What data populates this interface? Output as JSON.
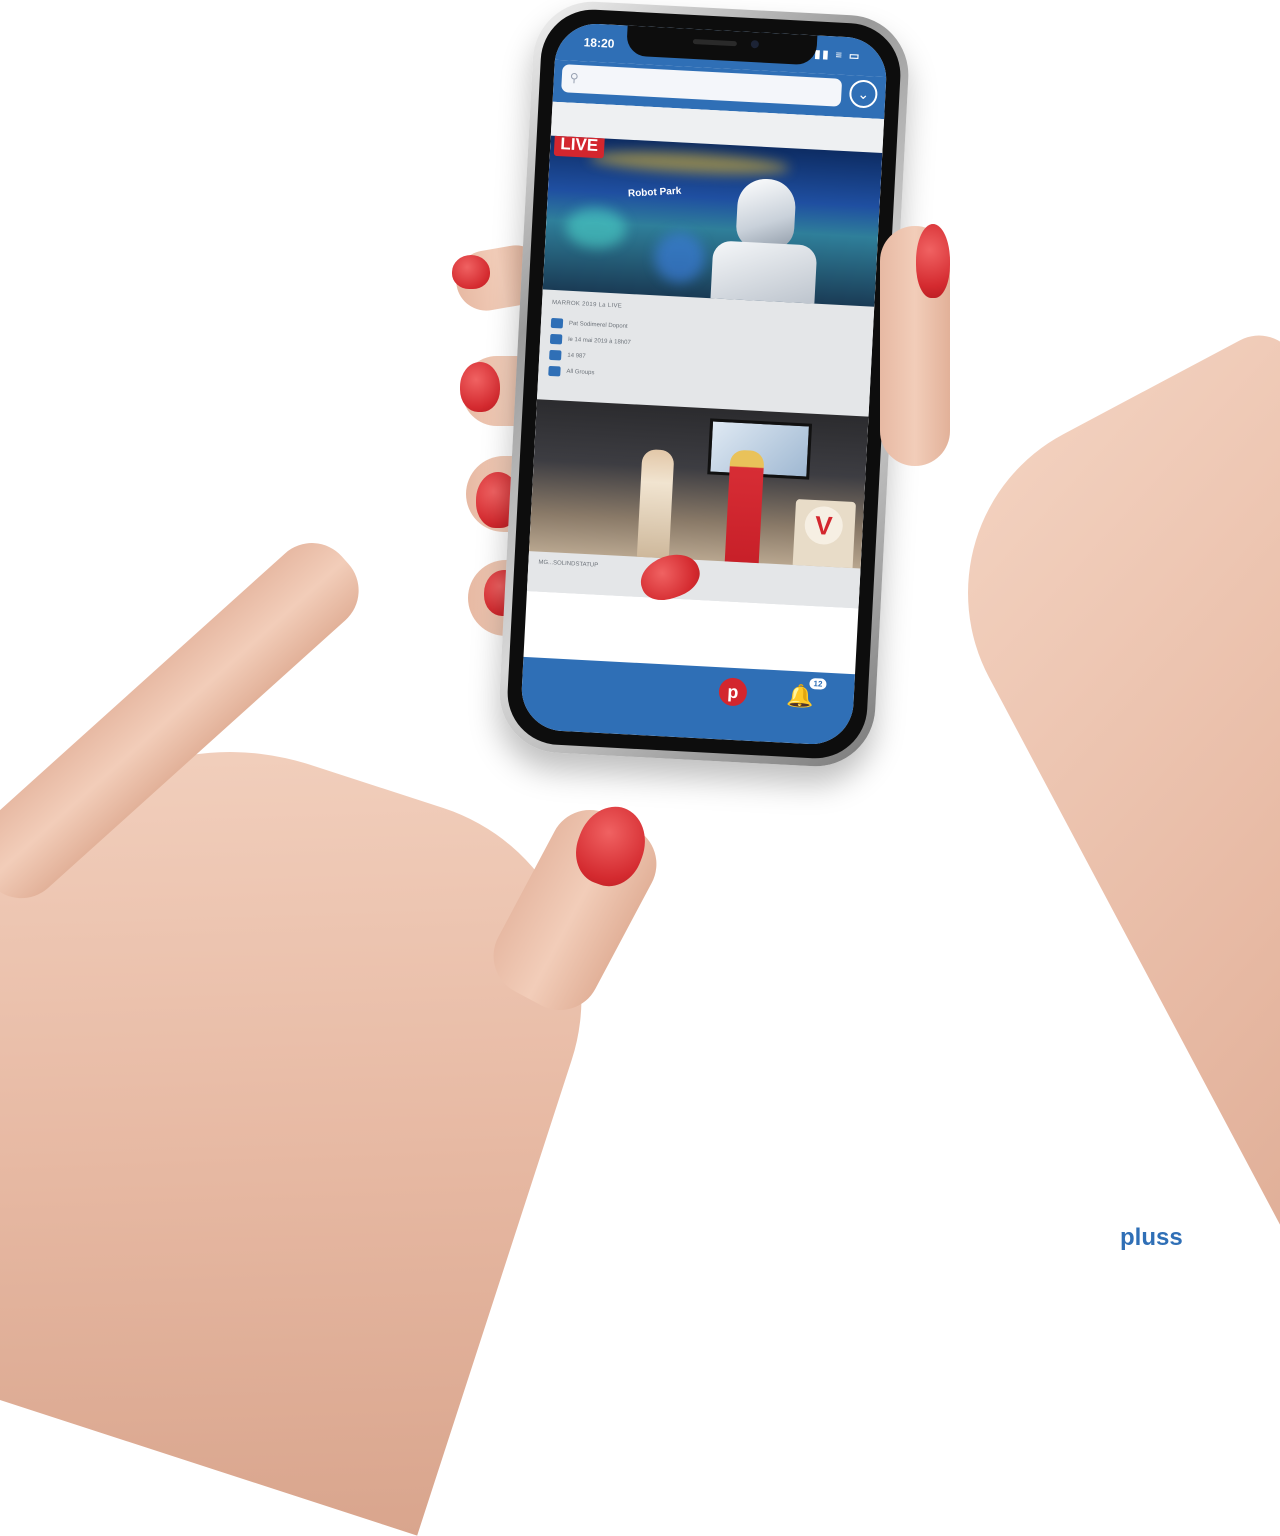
{
  "status_bar": {
    "time": "18:20",
    "icons": "▮▮ ≡ ▭"
  },
  "search": {
    "placeholder": "",
    "value": ""
  },
  "feed": {
    "items": [
      {
        "badge": "LIVE",
        "sign": "Robot Park",
        "title": "MARROK 2019 La LIVE",
        "meta": [
          {
            "icon": "person-icon",
            "text": "Pat  Sodimerel Dopont"
          },
          {
            "icon": "calendar-icon",
            "text": "le 14 mai 2019 à 18h07"
          },
          {
            "icon": "eye-icon",
            "text": "14 987"
          },
          {
            "icon": "group-icon",
            "text": "All Groups"
          }
        ]
      },
      {
        "kiosk_logo": "V",
        "title": "MG...SOLINDSTATUP"
      }
    ]
  },
  "tab_bar": {
    "home_label": "p",
    "notifications_count": "12"
  },
  "brand": "pluss"
}
